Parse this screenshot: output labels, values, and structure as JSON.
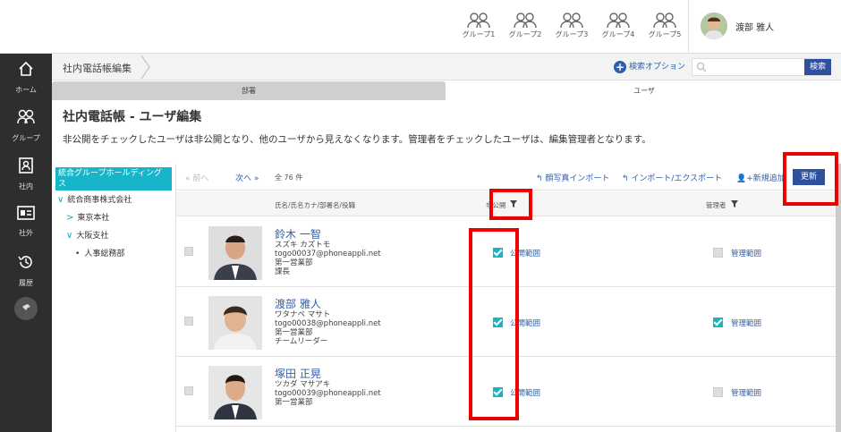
{
  "topbar": {
    "groups": [
      "グループ1",
      "グループ2",
      "グループ3",
      "グループ4",
      "グループ5"
    ],
    "user_name": "渡部 雅人"
  },
  "sidebar": {
    "items": [
      {
        "label": "ホーム",
        "icon": "home-icon"
      },
      {
        "label": "グループ",
        "icon": "group-icon"
      },
      {
        "label": "社内",
        "icon": "contact-book-icon"
      },
      {
        "label": "社外",
        "icon": "id-card-icon"
      },
      {
        "label": "履歴",
        "icon": "history-icon"
      }
    ]
  },
  "breadcrumb": {
    "title": "社内電話帳編集"
  },
  "search": {
    "option_label": "検索オプション",
    "button_label": "検索",
    "placeholder": ""
  },
  "tabs": {
    "dept": "部署",
    "user": "ユーザ"
  },
  "page": {
    "title": "社内電話帳 - ユーザ編集",
    "description": "非公開をチェックしたユーザは非公開となり、他のユーザから見えなくなります。管理者をチェックしたユーザは、編集管理者となります。"
  },
  "tree": {
    "root": "統合グループホールディングス",
    "items": [
      "統合商事株式会社",
      "東京本社",
      "大阪支社",
      "人事総務部"
    ]
  },
  "toolbar": {
    "prev": "前へ",
    "next": "次へ",
    "count": "全 76 件",
    "photo_import": "顔写真インポート",
    "import_export": "インポート/エクスポート",
    "add_new": "新規追加",
    "update": "更新"
  },
  "table": {
    "headers": {
      "name": "氏名/氏名カナ/部署名/役職",
      "private": "非公開",
      "admin": "管理者"
    },
    "scope_private": "公開範囲",
    "scope_admin": "管理範囲",
    "rows": [
      {
        "name": "鈴木 一智",
        "kana": "スズキ カズトモ",
        "email": "togo00037@phoneappli.net",
        "dept": "第一営業部",
        "role": "課長",
        "private": true,
        "admin": false
      },
      {
        "name": "渡部 雅人",
        "kana": "ワタナベ マサト",
        "email": "togo00038@phoneappli.net",
        "dept": "第一営業部",
        "role": "チームリーダー",
        "private": true,
        "admin": true
      },
      {
        "name": "塚田 正晃",
        "kana": "ツカダ マサアキ",
        "email": "togo00039@phoneappli.net",
        "dept": "第一営業部",
        "role": "",
        "private": true,
        "admin": false
      }
    ]
  },
  "colors": {
    "accent": "#17b5c9",
    "link": "#2f5fa8",
    "button": "#2f4f9f",
    "highlight": "#e00000",
    "sidebar": "#2e2e2e"
  }
}
